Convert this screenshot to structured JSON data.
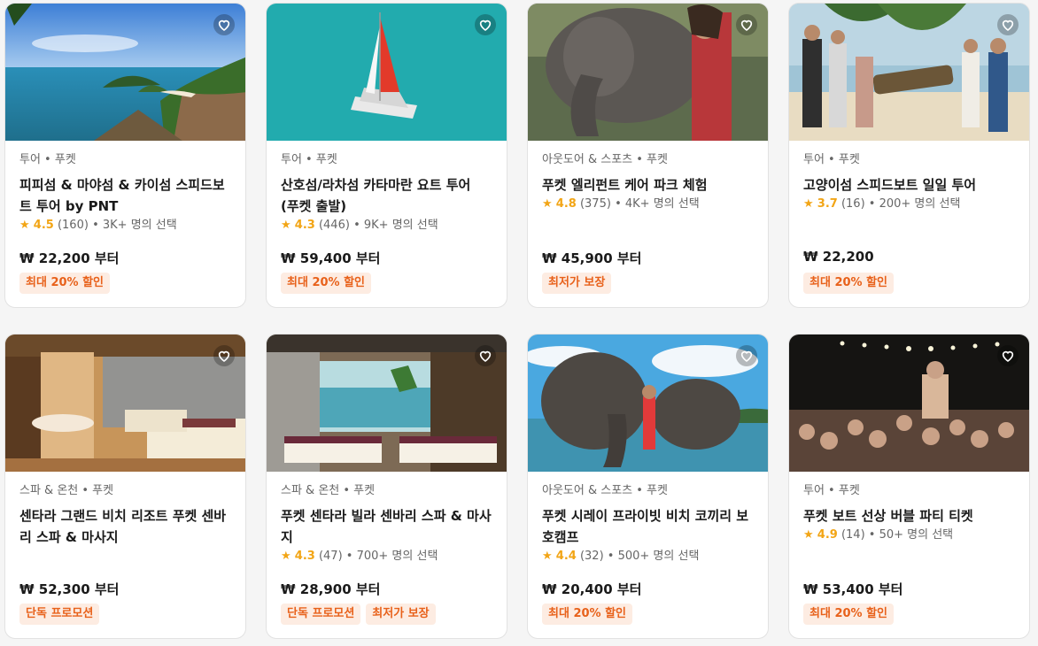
{
  "cards": [
    {
      "category": "투어 • 푸켓",
      "title": "피피섬 & 마야섬 & 카이섬 스피드보트 투어 by PNT",
      "star": "★",
      "score": "4.5",
      "reviews": "(160)",
      "chosen": "• 3K+ 명의 선택",
      "price": "₩ 22,200 부터",
      "badges": [
        "최대 20% 할인"
      ],
      "image": "island-coast-photo"
    },
    {
      "category": "투어 • 푸켓",
      "title": "산호섬/라차섬 카타마란 요트 투어 (푸켓 출발)",
      "star": "★",
      "score": "4.3",
      "reviews": "(446)",
      "chosen": "• 9K+ 명의 선택",
      "price": "₩ 59,400 부터",
      "badges": [
        "최대 20% 할인"
      ],
      "image": "catamaran-photo"
    },
    {
      "category": "아웃도어 & 스포츠 • 푸켓",
      "title": "푸켓 엘리펀트 케어 파크 체험",
      "star": "★",
      "score": "4.8",
      "reviews": "(375)",
      "chosen": "• 4K+ 명의 선택",
      "price": "₩ 45,900 부터",
      "badges": [
        "최저가 보장"
      ],
      "image": "elephant-photo"
    },
    {
      "category": "투어 • 푸켓",
      "title": "고양이섬 스피드보트 일일 투어",
      "star": "★",
      "score": "3.7",
      "reviews": "(16)",
      "chosen": "• 200+ 명의 선택",
      "price": "₩ 22,200",
      "badges": [
        "최대 20% 할인"
      ],
      "image": "group-island-photo"
    },
    {
      "category": "스파 & 온천 • 푸켓",
      "title": "센타라 그랜드 비치 리조트 푸켓 센바리 스파 & 마사지",
      "star": "",
      "score": "",
      "reviews": "",
      "chosen": "",
      "price": "₩ 52,300 부터",
      "badges": [
        "단독 프로모션"
      ],
      "image": "spa-room-photo"
    },
    {
      "category": "스파 & 온천 • 푸켓",
      "title": "푸켓 센타라 빌라 센바리 스파 & 마사지",
      "star": "★",
      "score": "4.3",
      "reviews": "(47)",
      "chosen": "• 700+ 명의 선택",
      "price": "₩ 28,900 부터",
      "badges": [
        "단독 프로모션",
        "최저가 보장"
      ],
      "image": "spa-villa-photo"
    },
    {
      "category": "아웃도어 & 스포츠 • 푸켓",
      "title": "푸켓 시레이 프라이빗 비치 코끼리 보호캠프",
      "star": "★",
      "score": "4.4",
      "reviews": "(32)",
      "chosen": "• 500+ 명의 선택",
      "price": "₩ 20,400 부터",
      "badges": [
        "최대 20% 할인"
      ],
      "image": "elephant-beach-photo"
    },
    {
      "category": "투어 • 푸켓",
      "title": "푸켓 보트 선상 버블 파티 티켓",
      "star": "★",
      "score": "4.9",
      "reviews": "(14)",
      "chosen": "• 50+ 명의 선택",
      "price": "₩ 53,400 부터",
      "badges": [
        "최대 20% 할인"
      ],
      "image": "boat-party-photo"
    }
  ],
  "colors": {
    "accent": "#e8611a",
    "badge_bg": "#fdece2",
    "star": "#f2a516"
  }
}
